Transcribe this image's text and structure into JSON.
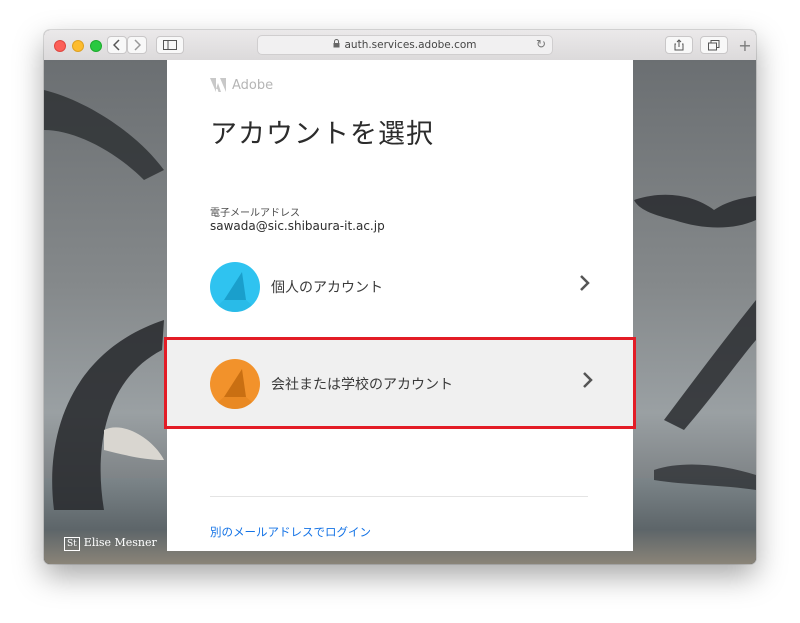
{
  "browser": {
    "url": "auth.services.adobe.com",
    "tab_plus": "+"
  },
  "background": {
    "credit_badge": "St",
    "credit_name": "Elise Mesner"
  },
  "card": {
    "brand": "Adobe",
    "title": "アカウントを選択",
    "email_label": "電子メールアドレス",
    "email_value": "sawada@sic.shibaura-it.ac.jp",
    "options": [
      {
        "label": "個人のアカウント",
        "color": "#2fc3f0",
        "selected": false
      },
      {
        "label": "会社または学校のアカウント",
        "color": "#f2922b",
        "selected": true
      }
    ],
    "alt_link": "別のメールアドレスでログイン"
  },
  "colors": {
    "highlight": "#e31c26",
    "link": "#1473e6"
  }
}
